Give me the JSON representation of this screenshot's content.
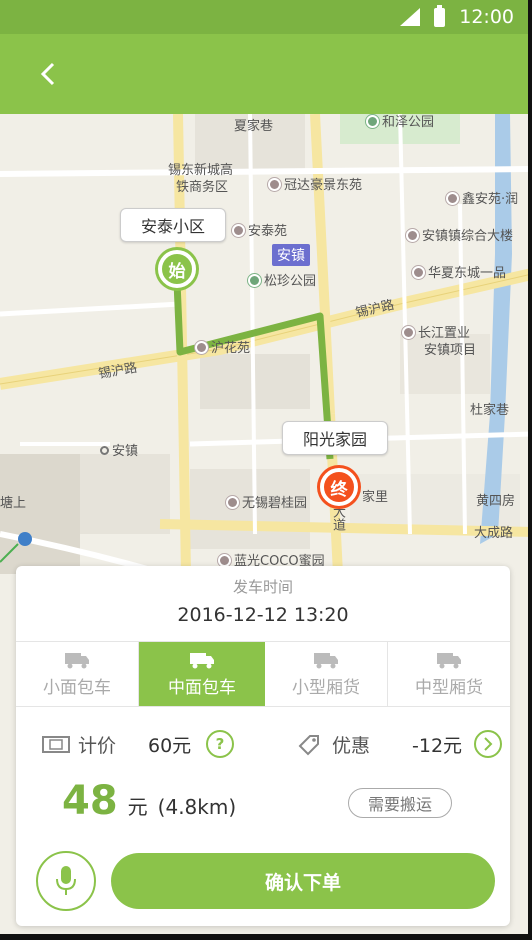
{
  "status_bar": {
    "time": "12:00"
  },
  "toolbar": {
    "back_icon": "chevron-left-icon"
  },
  "map": {
    "labels": {
      "xiajiaxiang": "夏家巷",
      "hezegongyuan": "和泽公园",
      "xidong_line1": "锡东新城高",
      "xidong_line2": "铁商务区",
      "guanda": "冠达豪景东苑",
      "xinan": "鑫安苑·润",
      "antaiyuan": "安泰苑",
      "anzhen_town_hall": "安镇镇综合大楼",
      "songzhen": "松珍公园",
      "huaxia": "华夏东城一品",
      "xihu_road_right": "锡沪路",
      "xihu_road_left": "锡沪路",
      "huxiangyuan": "沪花苑",
      "changjiang_line1": "长江置业",
      "changjiang_line2": "安镇项目",
      "dujiaqiao": "杜家巷",
      "anzhen_stop": "安镇",
      "huangsiliu": "黄四房",
      "wuxi_biguiyuan": "无锡碧桂园",
      "jiali": "家里",
      "dacheng_road": "大成路",
      "languang": "蓝光COCO蜜园",
      "dongdadao": "东大道",
      "tangshang": "塘上",
      "metro": "安镇"
    },
    "start_location": "安泰小区",
    "end_location": "阳光家园",
    "start_pin": "始",
    "end_pin": "终",
    "colors": {
      "route": "#7cb342",
      "start": "#8bc34a",
      "end": "#f4511e"
    }
  },
  "order": {
    "depart_label": "发车时间",
    "depart_time": "2016-12-12 13:20",
    "vehicles": [
      {
        "label": "小面包车",
        "active": false
      },
      {
        "label": "中面包车",
        "active": true
      },
      {
        "label": "小型厢货",
        "active": false
      },
      {
        "label": "中型厢货",
        "active": false
      }
    ],
    "pricing_label": "计价",
    "pricing_value": "60元",
    "pricing_info": "?",
    "discount_label": "优惠",
    "discount_value": "-12元",
    "total_amount": "48",
    "total_unit": "元",
    "total_distance": "(4.8km)",
    "carry_label": "需要搬运",
    "confirm_label": "确认下单",
    "accent": "#8bc34a"
  }
}
